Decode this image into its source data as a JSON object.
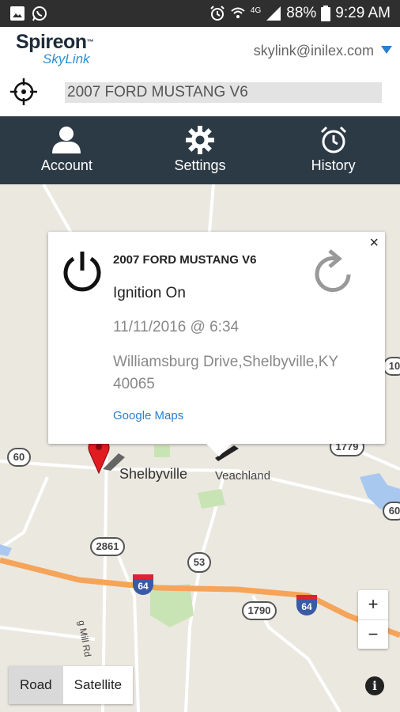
{
  "status_bar": {
    "battery": "88%",
    "time": "9:29 AM",
    "network": "4G"
  },
  "header": {
    "logo_brand": "Spireon",
    "logo_product": "SkyLink",
    "user_email": "skylink@inilex.com",
    "vehicle": "2007 FORD MUSTANG V6"
  },
  "nav": {
    "items": [
      {
        "label": "Account",
        "icon": "person-icon"
      },
      {
        "label": "Settings",
        "icon": "gear-icon"
      },
      {
        "label": "History",
        "icon": "alarm-clock-icon"
      }
    ]
  },
  "popup": {
    "title": "2007 FORD MUSTANG V6",
    "status": "Ignition On",
    "timestamp": "11/11/2016 @ 6:34",
    "address": "Williamsburg Drive,Shelbyville,KY 40065",
    "link": "Google Maps",
    "close": "×"
  },
  "map": {
    "town": "Shelbyville",
    "places": [
      "Veachland"
    ],
    "road_shields": [
      "60",
      "2861",
      "53",
      "64",
      "1790",
      "64",
      "1779",
      "60",
      "10"
    ],
    "road_name": "g Mill Rd",
    "zoom_in": "+",
    "zoom_out": "−",
    "map_types": [
      "Road",
      "Satellite"
    ],
    "active_type": "Road",
    "info": "i"
  },
  "colors": {
    "nav_bg": "#2c3a45",
    "accent": "#2a7fd0",
    "interstate": "#3b5aa5",
    "highway": "#f5a45a",
    "marker": "#e11b22"
  }
}
